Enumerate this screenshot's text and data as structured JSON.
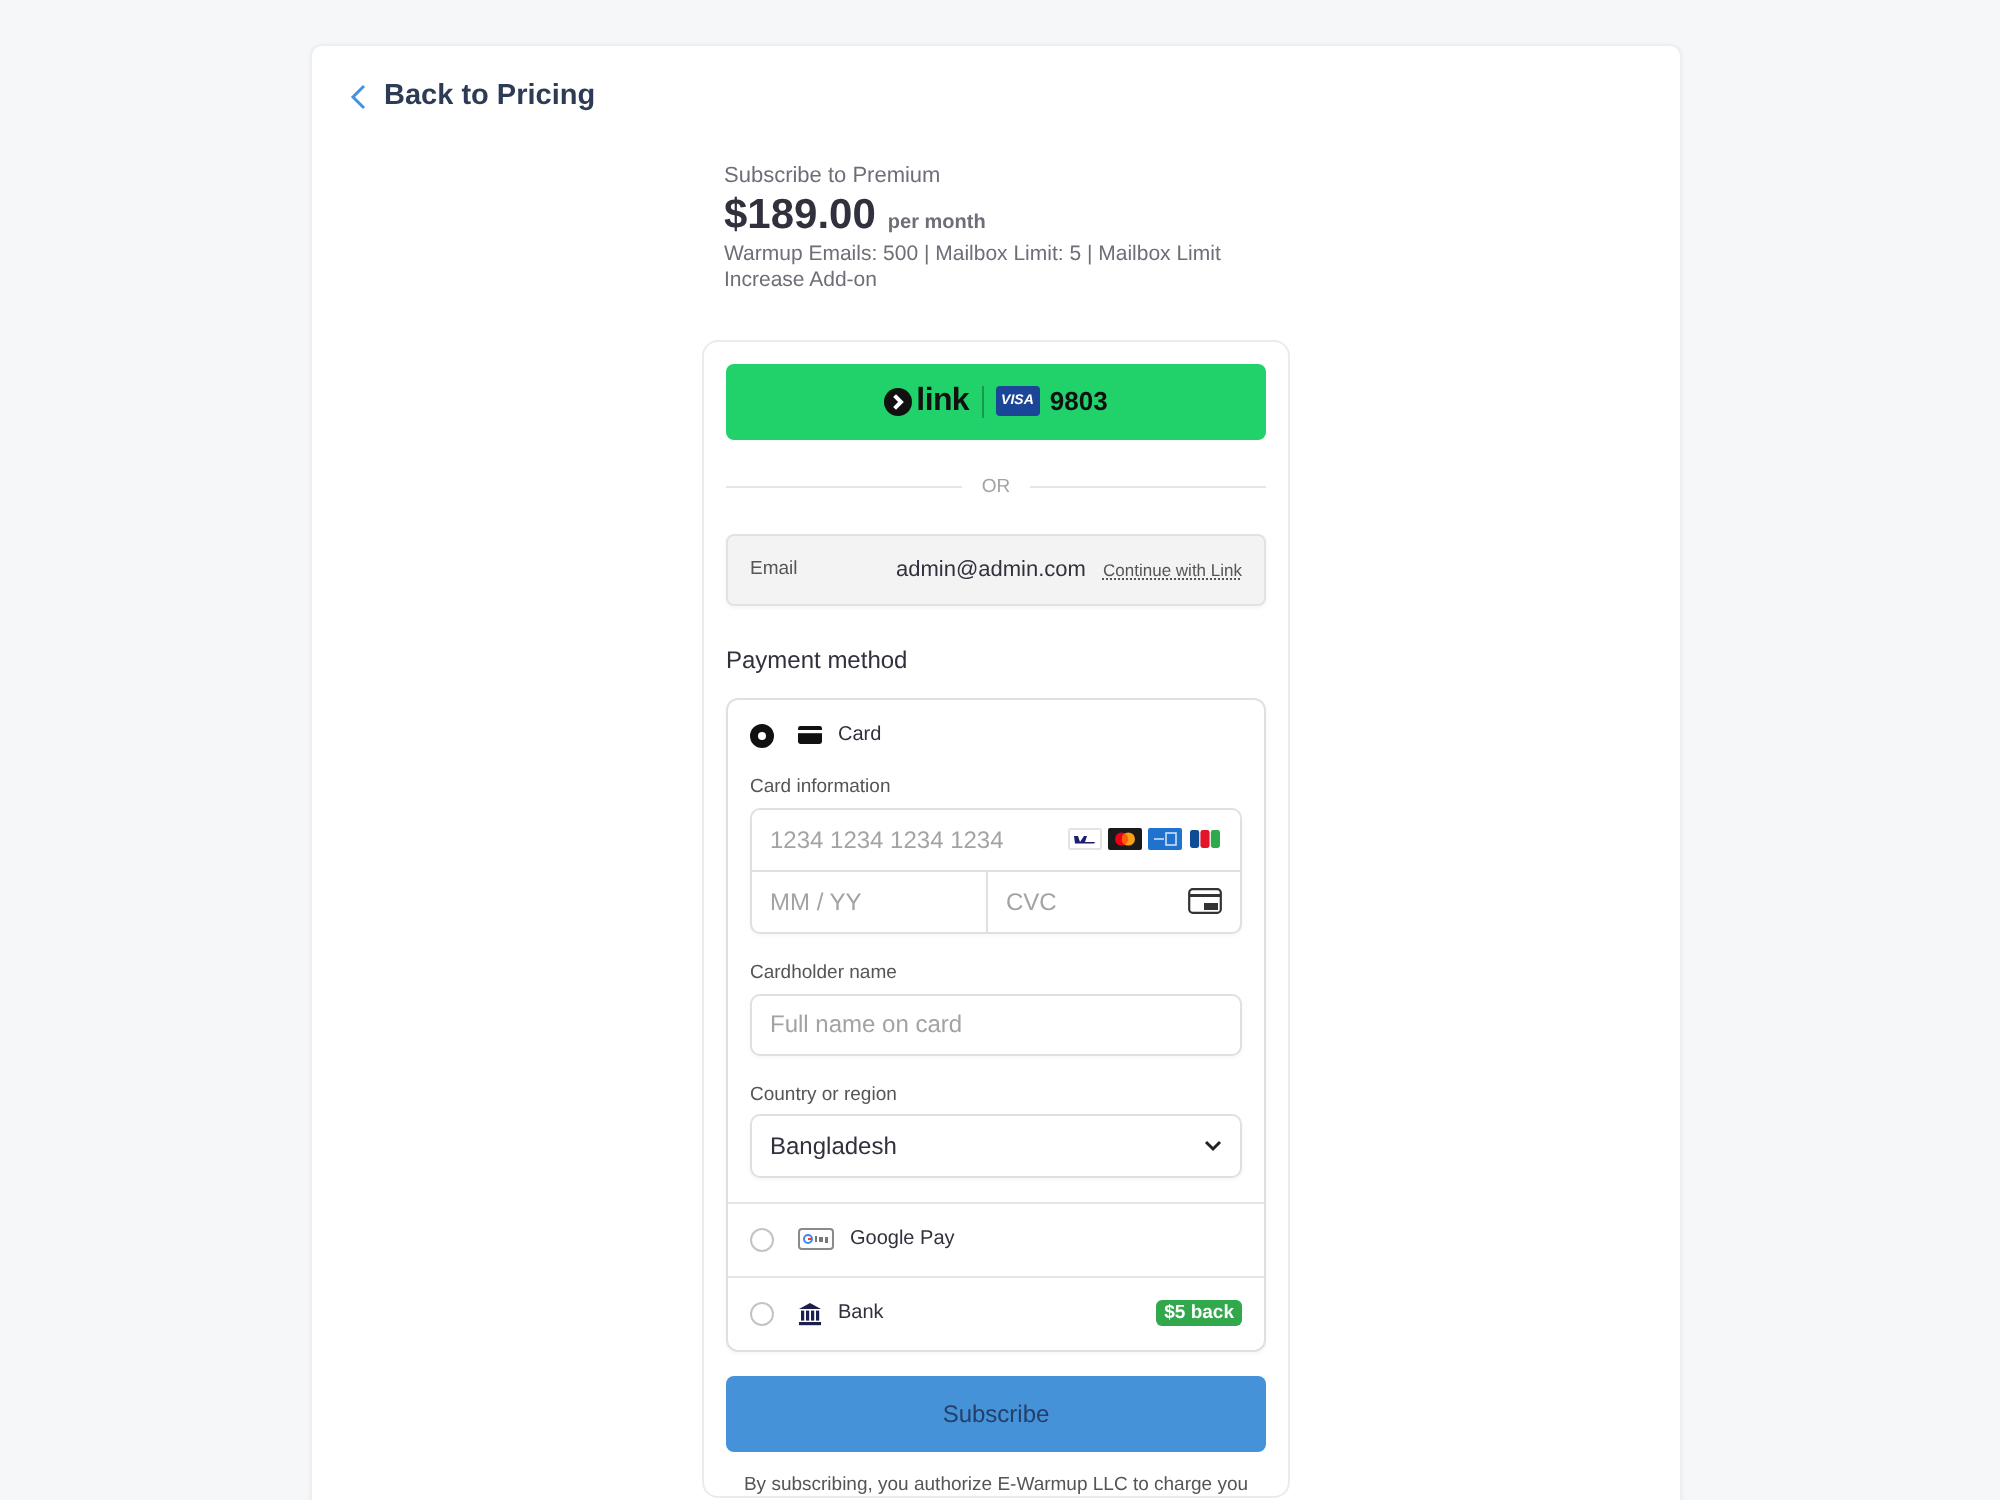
{
  "back_link": {
    "label": "Back to Pricing"
  },
  "summary": {
    "title": "Subscribe to Premium",
    "price": "$189.00",
    "period": "per month",
    "description": "Warmup Emails: 500 | Mailbox Limit: 5 | Mailbox Limit Increase Add-on"
  },
  "link_button": {
    "brand": "link",
    "card_brand": "VISA",
    "last4": "9803"
  },
  "divider": {
    "label": "OR"
  },
  "email": {
    "label": "Email",
    "value": "admin@admin.com",
    "action": "Continue with Link"
  },
  "payment": {
    "title": "Payment method",
    "methods": [
      {
        "kind": "card",
        "label": "Card",
        "selected": true,
        "form": {
          "card_info_label": "Card information",
          "card_number_placeholder": "1234 1234 1234 1234",
          "expiry_placeholder": "MM / YY",
          "cvc_placeholder": "CVC",
          "name_label": "Cardholder name",
          "name_placeholder": "Full name on card",
          "country_label": "Country or region",
          "country": "Bangladesh"
        }
      },
      {
        "kind": "google_pay",
        "label": "Google Pay",
        "selected": false
      },
      {
        "kind": "bank",
        "label": "Bank",
        "selected": false,
        "badge": "$5 back"
      }
    ]
  },
  "subscribe_button": {
    "label": "Subscribe"
  },
  "legal": {
    "text": "By subscribing, you authorize E-Warmup LLC to charge you"
  }
}
